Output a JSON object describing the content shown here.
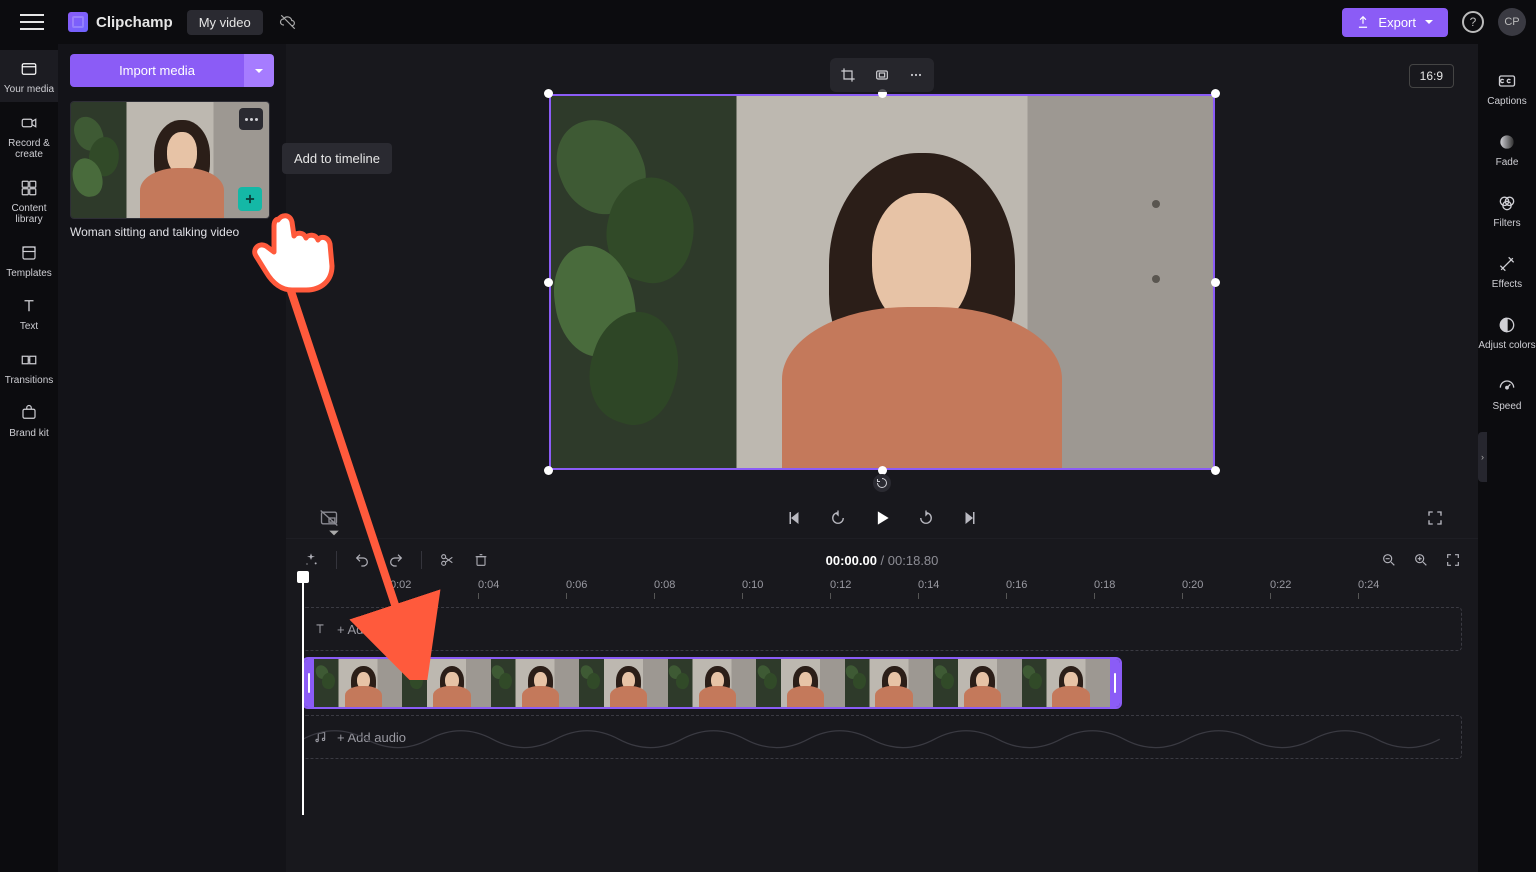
{
  "app": {
    "brand": "Clipchamp",
    "title": "My video"
  },
  "header": {
    "export": "Export",
    "avatar": "CP"
  },
  "left_rail": {
    "items": [
      {
        "label": "Your media"
      },
      {
        "label": "Record & create"
      },
      {
        "label": "Content library"
      },
      {
        "label": "Templates"
      },
      {
        "label": "Text"
      },
      {
        "label": "Transitions"
      },
      {
        "label": "Brand kit"
      }
    ]
  },
  "right_rail": {
    "items": [
      {
        "label": "Captions"
      },
      {
        "label": "Fade"
      },
      {
        "label": "Filters"
      },
      {
        "label": "Effects"
      },
      {
        "label": "Adjust colors"
      },
      {
        "label": "Speed"
      }
    ]
  },
  "media_panel": {
    "import": "Import media",
    "clip_caption": "Woman sitting and talking video",
    "tooltip": "Add to timeline"
  },
  "preview": {
    "aspect": "16:9"
  },
  "timeline": {
    "current": "00:00.00",
    "sep": " / ",
    "total": "00:18.80",
    "ticks": [
      "0:02",
      "0:04",
      "0:06",
      "0:08",
      "0:10",
      "0:12",
      "0:14",
      "0:16",
      "0:18",
      "0:20",
      "0:22",
      "0:24"
    ],
    "add_text": "+ Add text",
    "add_audio": "+ Add audio"
  }
}
